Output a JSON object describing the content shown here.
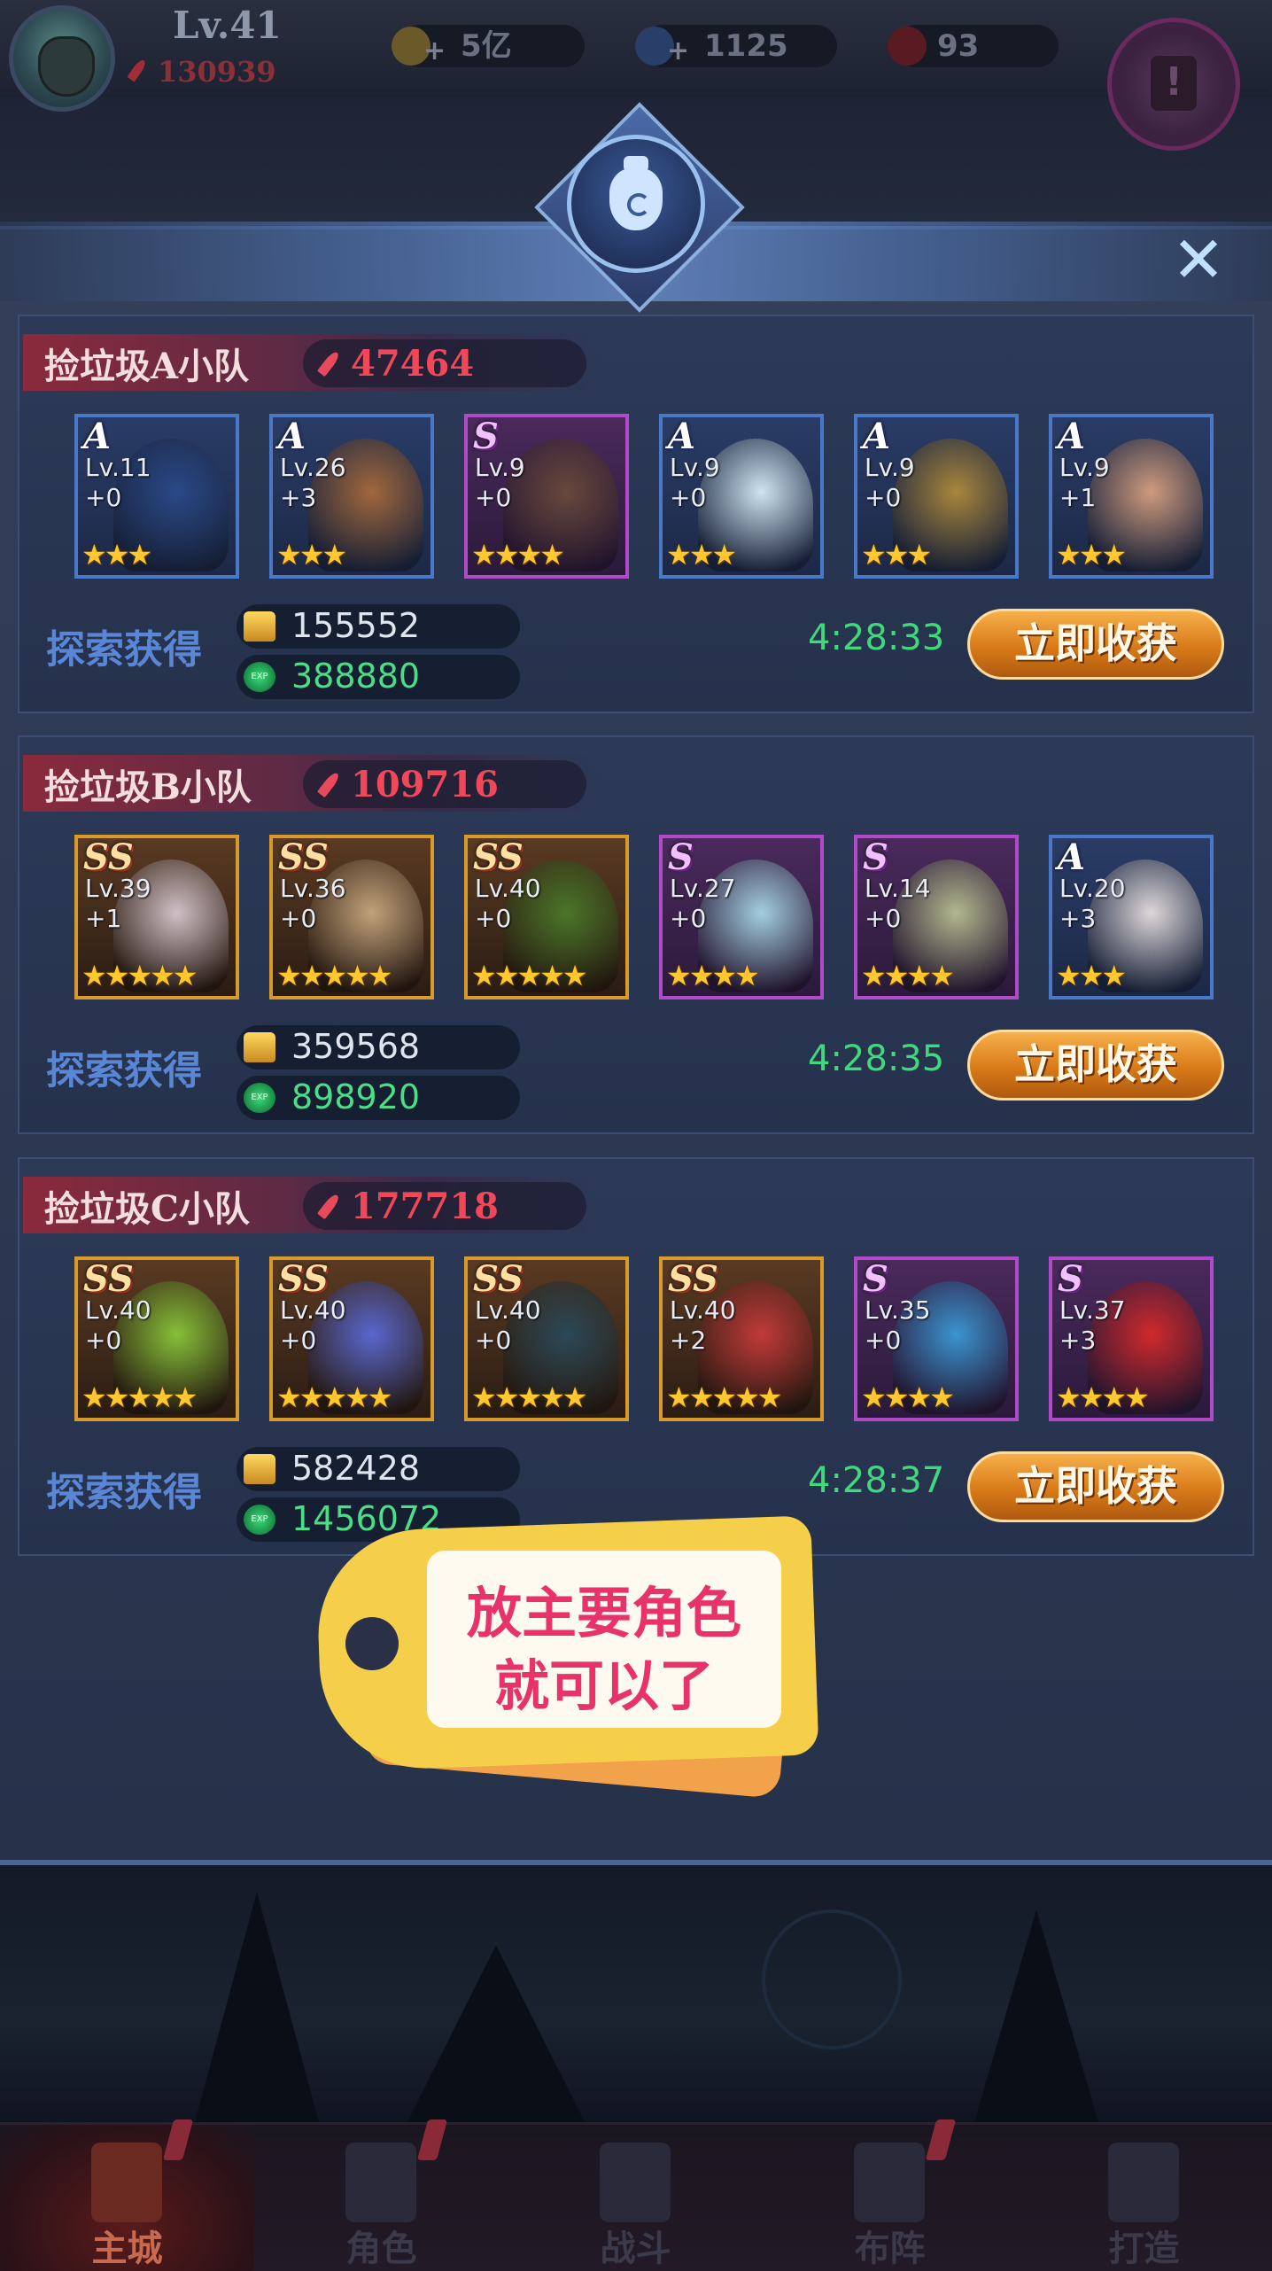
{
  "player": {
    "level": "Lv.41",
    "power": "130939"
  },
  "resources": [
    {
      "name": "gold",
      "value": "5亿",
      "icon": "gold-coin-icon",
      "color": "#c8a040"
    },
    {
      "name": "diamond",
      "value": "1125",
      "icon": "diamond-icon",
      "color": "#4a7ad8"
    },
    {
      "name": "ruby",
      "value": "93",
      "icon": "ruby-icon",
      "color": "#c8202e"
    }
  ],
  "squads": [
    {
      "name": "捡垃圾A小队",
      "power": "47464",
      "heroes": [
        {
          "grade": "A",
          "level": "Lv.11",
          "plus": "+0",
          "stars": "★★★",
          "rarity": "a",
          "color": "#2a4a8a"
        },
        {
          "grade": "A",
          "level": "Lv.26",
          "plus": "+3",
          "stars": "★★★",
          "rarity": "a",
          "color": "#a86a3a"
        },
        {
          "grade": "S",
          "level": "Lv.9",
          "plus": "+0",
          "stars": "★★★★",
          "rarity": "s",
          "color": "#6a4a3a"
        },
        {
          "grade": "A",
          "level": "Lv.9",
          "plus": "+0",
          "stars": "★★★",
          "rarity": "a",
          "color": "#d8eef8"
        },
        {
          "grade": "A",
          "level": "Lv.9",
          "plus": "+0",
          "stars": "★★★",
          "rarity": "a",
          "color": "#b08a3a"
        },
        {
          "grade": "A",
          "level": "Lv.9",
          "plus": "+1",
          "stars": "★★★",
          "rarity": "a",
          "color": "#d8a080"
        }
      ],
      "gold": "155552",
      "exp": "388880",
      "timer": "4:28:33"
    },
    {
      "name": "捡垃圾B小队",
      "power": "109716",
      "heroes": [
        {
          "grade": "SS",
          "level": "Lv.39",
          "plus": "+1",
          "stars": "★★★★★",
          "rarity": "ss",
          "color": "#d8c8d0"
        },
        {
          "grade": "SS",
          "level": "Lv.36",
          "plus": "+0",
          "stars": "★★★★★",
          "rarity": "ss",
          "color": "#c8a880"
        },
        {
          "grade": "SS",
          "level": "Lv.40",
          "plus": "+0",
          "stars": "★★★★★",
          "rarity": "ss",
          "color": "#4a7a2a"
        },
        {
          "grade": "S",
          "level": "Lv.27",
          "plus": "+0",
          "stars": "★★★★",
          "rarity": "s",
          "color": "#a8d8e8"
        },
        {
          "grade": "S",
          "level": "Lv.14",
          "plus": "+0",
          "stars": "★★★★",
          "rarity": "s",
          "color": "#b8c090"
        },
        {
          "grade": "A",
          "level": "Lv.20",
          "plus": "+3",
          "stars": "★★★",
          "rarity": "a",
          "color": "#e8e0e0"
        }
      ],
      "gold": "359568",
      "exp": "898920",
      "timer": "4:28:35"
    },
    {
      "name": "捡垃圾C小队",
      "power": "177718",
      "heroes": [
        {
          "grade": "SS",
          "level": "Lv.40",
          "plus": "+0",
          "stars": "★★★★★",
          "rarity": "ss",
          "color": "#8ac83a"
        },
        {
          "grade": "SS",
          "level": "Lv.40",
          "plus": "+0",
          "stars": "★★★★★",
          "rarity": "ss",
          "color": "#5a6ad8"
        },
        {
          "grade": "SS",
          "level": "Lv.40",
          "plus": "+0",
          "stars": "★★★★★",
          "rarity": "ss",
          "color": "#2a4a5a"
        },
        {
          "grade": "SS",
          "level": "Lv.40",
          "plus": "+2",
          "stars": "★★★★★",
          "rarity": "ss",
          "color": "#c83a3a"
        },
        {
          "grade": "S",
          "level": "Lv.35",
          "plus": "+0",
          "stars": "★★★★",
          "rarity": "s",
          "color": "#3a9ad8"
        },
        {
          "grade": "S",
          "level": "Lv.37",
          "plus": "+3",
          "stars": "★★★★",
          "rarity": "s",
          "color": "#d82a2a"
        }
      ],
      "gold": "582428",
      "exp": "1456072",
      "timer": "4:28:37"
    }
  ],
  "labels": {
    "explore": "探索获得",
    "collect": "立即收获",
    "close": "✕",
    "exp_icon": "EXP"
  },
  "tag_note": {
    "line1": "放主要角色",
    "line2": "就可以了"
  },
  "nav": [
    {
      "label": "主城",
      "active": true,
      "alert": true
    },
    {
      "label": "角色",
      "active": false,
      "alert": true
    },
    {
      "label": "战斗",
      "active": false,
      "alert": false
    },
    {
      "label": "布阵",
      "active": false,
      "alert": true
    },
    {
      "label": "打造",
      "active": false,
      "alert": false
    }
  ]
}
